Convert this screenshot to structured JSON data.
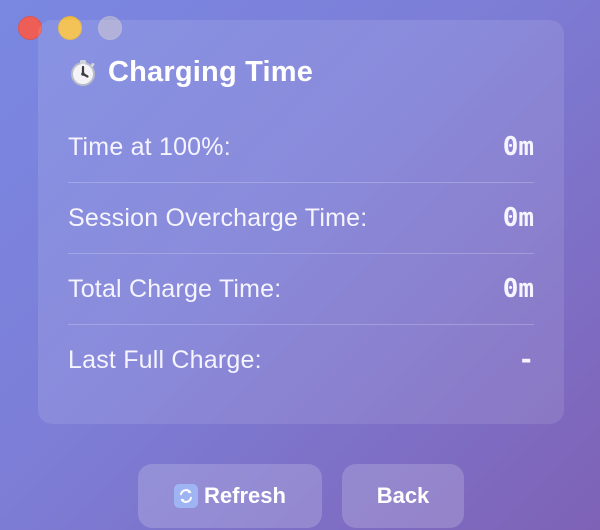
{
  "window": {
    "controls": [
      "close",
      "minimize",
      "maximize"
    ]
  },
  "card": {
    "title_icon": "stopwatch-icon",
    "title": "Charging Time",
    "rows": [
      {
        "label": "Time at 100%:",
        "value": "0m"
      },
      {
        "label": "Session Overcharge Time:",
        "value": "0m"
      },
      {
        "label": "Total Charge Time:",
        "value": "0m"
      },
      {
        "label": "Last Full Charge:",
        "value": "-"
      }
    ]
  },
  "buttons": {
    "refresh": {
      "icon": "refresh-icon",
      "label": "Refresh"
    },
    "back": {
      "label": "Back"
    }
  },
  "colors": {
    "background_start": "#7a88e2",
    "background_end": "#7e62b6",
    "close": "#ee5e57",
    "minimize": "#f2bd45",
    "maximize": "#a9a9d6"
  }
}
